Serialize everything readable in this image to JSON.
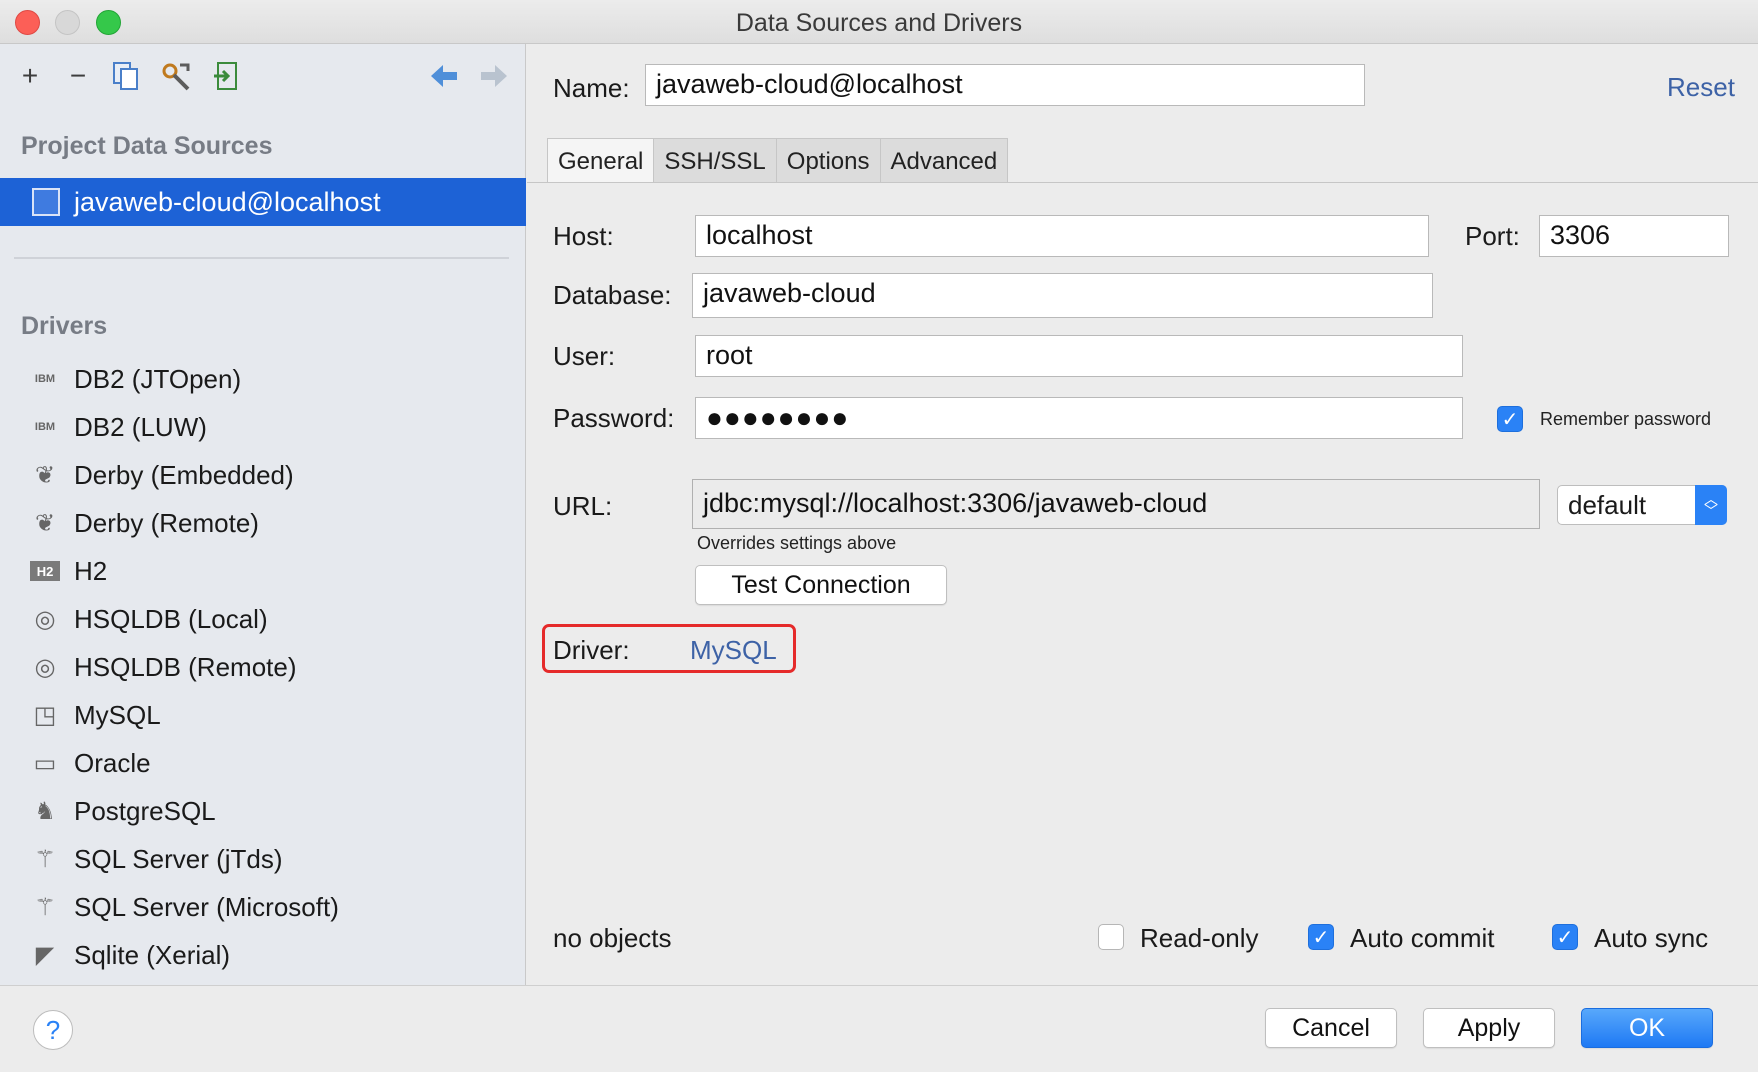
{
  "window": {
    "title": "Data Sources and Drivers"
  },
  "toolbar": {
    "icons": [
      "add-icon",
      "remove-icon",
      "copy-icon",
      "settings-icon",
      "import-icon",
      "back-arrow-icon",
      "forward-arrow-icon"
    ]
  },
  "sidebar": {
    "project_title": "Project Data Sources",
    "selected": "javaweb-cloud@localhost",
    "drivers_title": "Drivers",
    "drivers": [
      {
        "label": "DB2 (JTOpen)",
        "icon": "IBM"
      },
      {
        "label": "DB2 (LUW)",
        "icon": "IBM"
      },
      {
        "label": "Derby (Embedded)",
        "icon": "feather"
      },
      {
        "label": "Derby (Remote)",
        "icon": "feather"
      },
      {
        "label": "H2",
        "icon": "H2"
      },
      {
        "label": "HSQLDB (Local)",
        "icon": "hsqldb"
      },
      {
        "label": "HSQLDB (Remote)",
        "icon": "hsqldb"
      },
      {
        "label": "MySQL",
        "icon": "mysql"
      },
      {
        "label": "Oracle",
        "icon": "oracle"
      },
      {
        "label": "PostgreSQL",
        "icon": "elephant"
      },
      {
        "label": "SQL Server (jTds)",
        "icon": "sqlserver"
      },
      {
        "label": "SQL Server (Microsoft)",
        "icon": "sqlserver"
      },
      {
        "label": "Sqlite (Xerial)",
        "icon": "sqlite"
      }
    ]
  },
  "form": {
    "name_label": "Name:",
    "name_value": "javaweb-cloud@localhost",
    "reset_label": "Reset",
    "tabs": [
      "General",
      "SSH/SSL",
      "Options",
      "Advanced"
    ],
    "host_label": "Host:",
    "host_value": "localhost",
    "port_label": "Port:",
    "port_value": "3306",
    "database_label": "Database:",
    "database_value": "javaweb-cloud",
    "user_label": "User:",
    "user_value": "root",
    "password_label": "Password:",
    "password_value": "●●●●●●●●",
    "remember_password_label": "Remember password",
    "url_label": "URL:",
    "url_value": "jdbc:mysql://localhost:3306/javaweb-cloud",
    "url_mode": "default",
    "url_hint": "Overrides settings above",
    "test_connection_label": "Test Connection",
    "driver_label": "Driver:",
    "driver_value": "MySQL",
    "status": "no objects",
    "readonly_label": "Read-only",
    "autocommit_label": "Auto commit",
    "autosync_label": "Auto sync"
  },
  "footer": {
    "help_label": "?",
    "cancel_label": "Cancel",
    "apply_label": "Apply",
    "ok_label": "OK"
  },
  "colors": {
    "selection": "#1d62d6",
    "accent": "#2a82f6",
    "link": "#3d62a6",
    "highlight": "#e52a2a"
  }
}
